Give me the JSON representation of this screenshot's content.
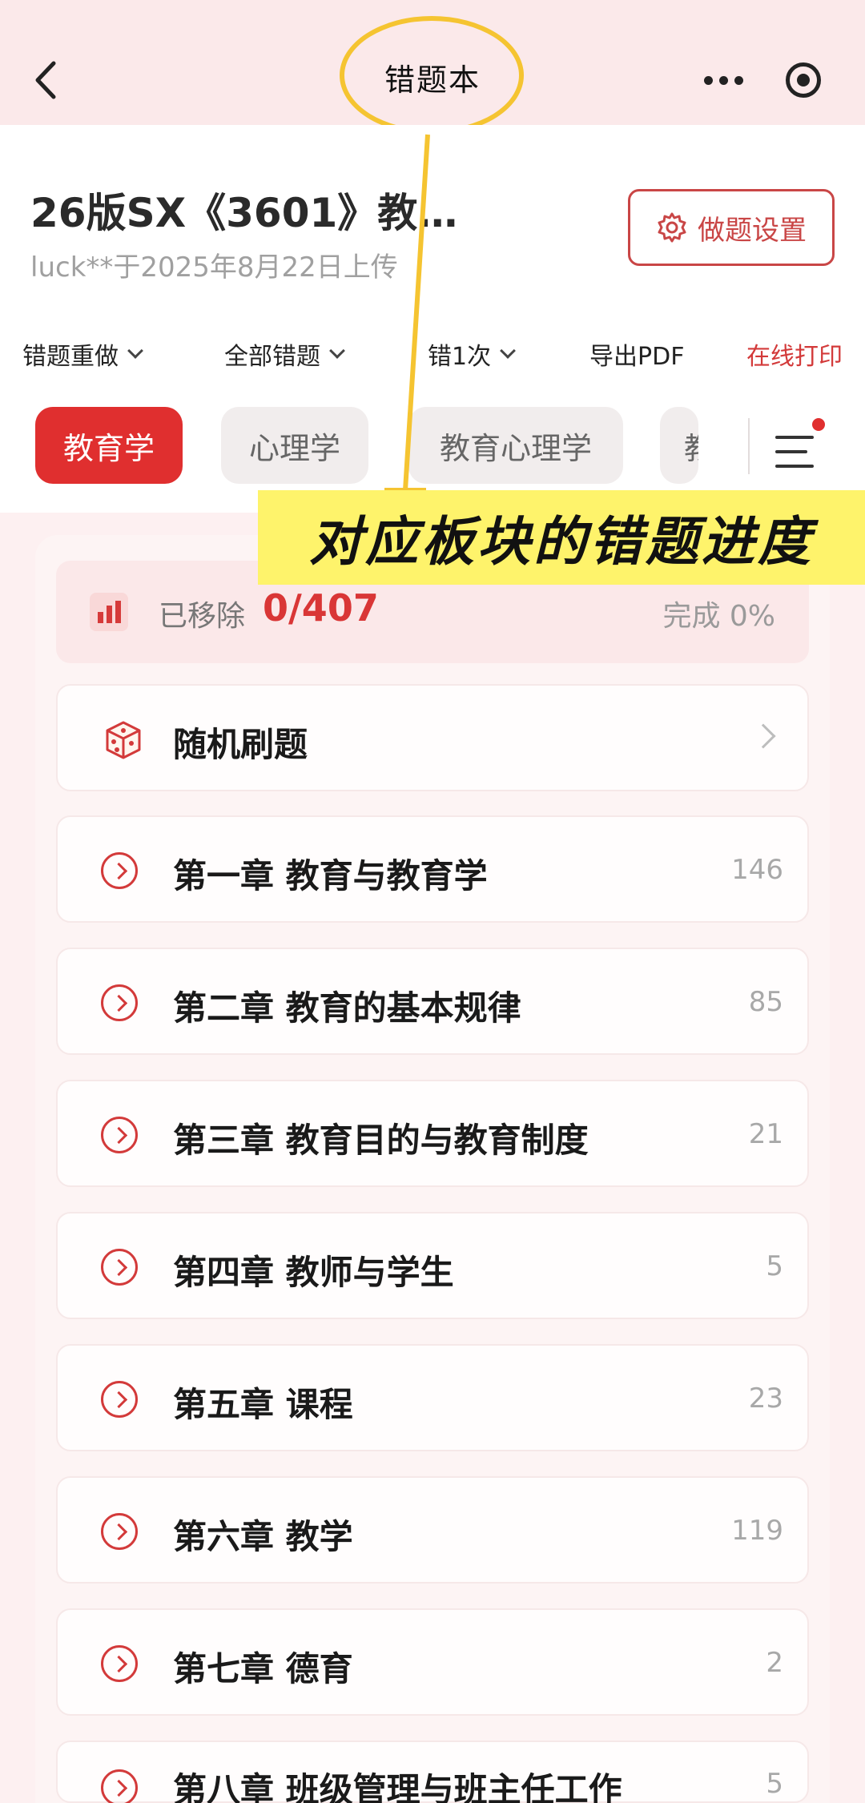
{
  "nav": {
    "title": "错题本"
  },
  "book": {
    "title": "26版SX《3601》教…",
    "uploader": "luck**于2025年8月22日上传",
    "settings_label": "做题设置"
  },
  "filters": {
    "redo": "错题重做",
    "all": "全部错题",
    "wrong_times": "错1次",
    "export": "导出PDF",
    "print": "在线打印"
  },
  "tabs": [
    "教育学",
    "心理学",
    "教育心理学",
    "教"
  ],
  "annotation": "对应板块的错题进度",
  "progress": {
    "removed_label": "已移除",
    "removed_value": "0/407",
    "complete_label": "完成 0%"
  },
  "random": {
    "label": "随机刷题"
  },
  "chapters": [
    {
      "label": "第一章 教育与教育学",
      "count": "146"
    },
    {
      "label": "第二章 教育的基本规律",
      "count": "85"
    },
    {
      "label": "第三章 教育目的与教育制度",
      "count": "21"
    },
    {
      "label": "第四章 教师与学生",
      "count": "5"
    },
    {
      "label": "第五章 课程",
      "count": "23"
    },
    {
      "label": "第六章 教学",
      "count": "119"
    },
    {
      "label": "第七章 德育",
      "count": "2"
    },
    {
      "label": "第八章 班级管理与班主任工作",
      "count": "5"
    }
  ],
  "colors": {
    "accent": "#e02f2f",
    "highlight": "#f5c431",
    "banner": "#fef36b"
  }
}
